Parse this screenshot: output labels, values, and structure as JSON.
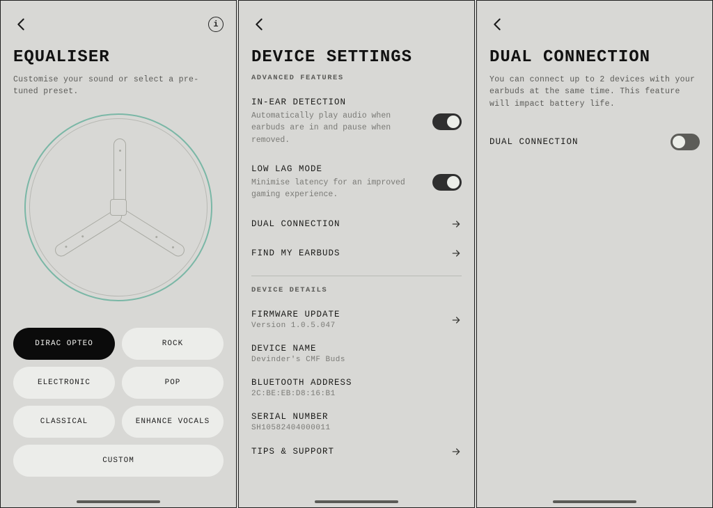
{
  "screen1": {
    "title": "EQUALISER",
    "subtitle": "Customise your sound or select a pre-tuned preset.",
    "presets": [
      {
        "label": "DIRAC OPTEO",
        "active": true
      },
      {
        "label": "ROCK",
        "active": false
      },
      {
        "label": "ELECTRONIC",
        "active": false
      },
      {
        "label": "POP",
        "active": false
      },
      {
        "label": "CLASSICAL",
        "active": false
      },
      {
        "label": "ENHANCE VOCALS",
        "active": false
      },
      {
        "label": "CUSTOM",
        "active": false
      }
    ]
  },
  "screen2": {
    "title": "DEVICE SETTINGS",
    "section1": "ADVANCED FEATURES",
    "in_ear": {
      "title": "IN-EAR DETECTION",
      "desc": "Automatically play audio when earbuds are in and pause when removed.",
      "on": true
    },
    "low_lag": {
      "title": "LOW LAG MODE",
      "desc": "Minimise latency for an improved gaming experience.",
      "on": true
    },
    "dual_connection": {
      "title": "DUAL CONNECTION"
    },
    "find_earbuds": {
      "title": "FIND MY EARBUDS"
    },
    "section2": "DEVICE DETAILS",
    "firmware": {
      "title": "FIRMWARE UPDATE",
      "value": "Version 1.0.5.047"
    },
    "name": {
      "title": "DEVICE NAME",
      "value": "Devinder's CMF Buds"
    },
    "bt": {
      "title": "BLUETOOTH ADDRESS",
      "value": "2C:BE:EB:D8:16:B1"
    },
    "serial": {
      "title": "SERIAL NUMBER",
      "value": "SH10582404000011"
    },
    "tips": {
      "title": "TIPS & SUPPORT"
    }
  },
  "screen3": {
    "title": "DUAL CONNECTION",
    "subtitle": "You can connect up to 2 devices with your earbuds at the same time. This feature will impact battery life.",
    "toggle_label": "DUAL CONNECTION",
    "toggle_on": false
  }
}
